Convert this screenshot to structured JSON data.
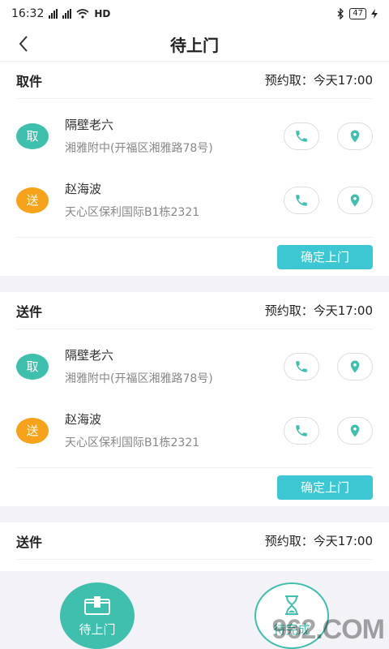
{
  "status_bar": {
    "time": "16:32",
    "network": "HD",
    "battery": "47"
  },
  "header": {
    "title": "待上门"
  },
  "orders": [
    {
      "type": "取件",
      "appointment": "预约取：今天17:00",
      "stops": [
        {
          "badge": "取",
          "name": "隔壁老六",
          "address": "湘雅附中(开福区湘雅路78号)"
        },
        {
          "badge": "送",
          "name": "赵海波",
          "address": "天心区保利国际B1栋2321"
        }
      ],
      "action": "确定上门"
    },
    {
      "type": "送件",
      "appointment": "预约取：今天17:00",
      "stops": [
        {
          "badge": "取",
          "name": "隔壁老六",
          "address": "湘雅附中(开福区湘雅路78号)"
        },
        {
          "badge": "送",
          "name": "赵海波",
          "address": "天心区保利国际B1栋2321"
        }
      ],
      "action": "确定上门"
    },
    {
      "type": "送件",
      "appointment": "预约取：今天17:00"
    }
  ],
  "tabs": [
    {
      "label": "待上门",
      "icon": "box-icon",
      "active": true
    },
    {
      "label": "待完成",
      "icon": "hourglass-icon",
      "active": false
    }
  ],
  "watermark": "962.COM",
  "colors": {
    "teal": "#3fbfae",
    "orange": "#f6a21a",
    "cyan_button": "#3cc7d3"
  }
}
